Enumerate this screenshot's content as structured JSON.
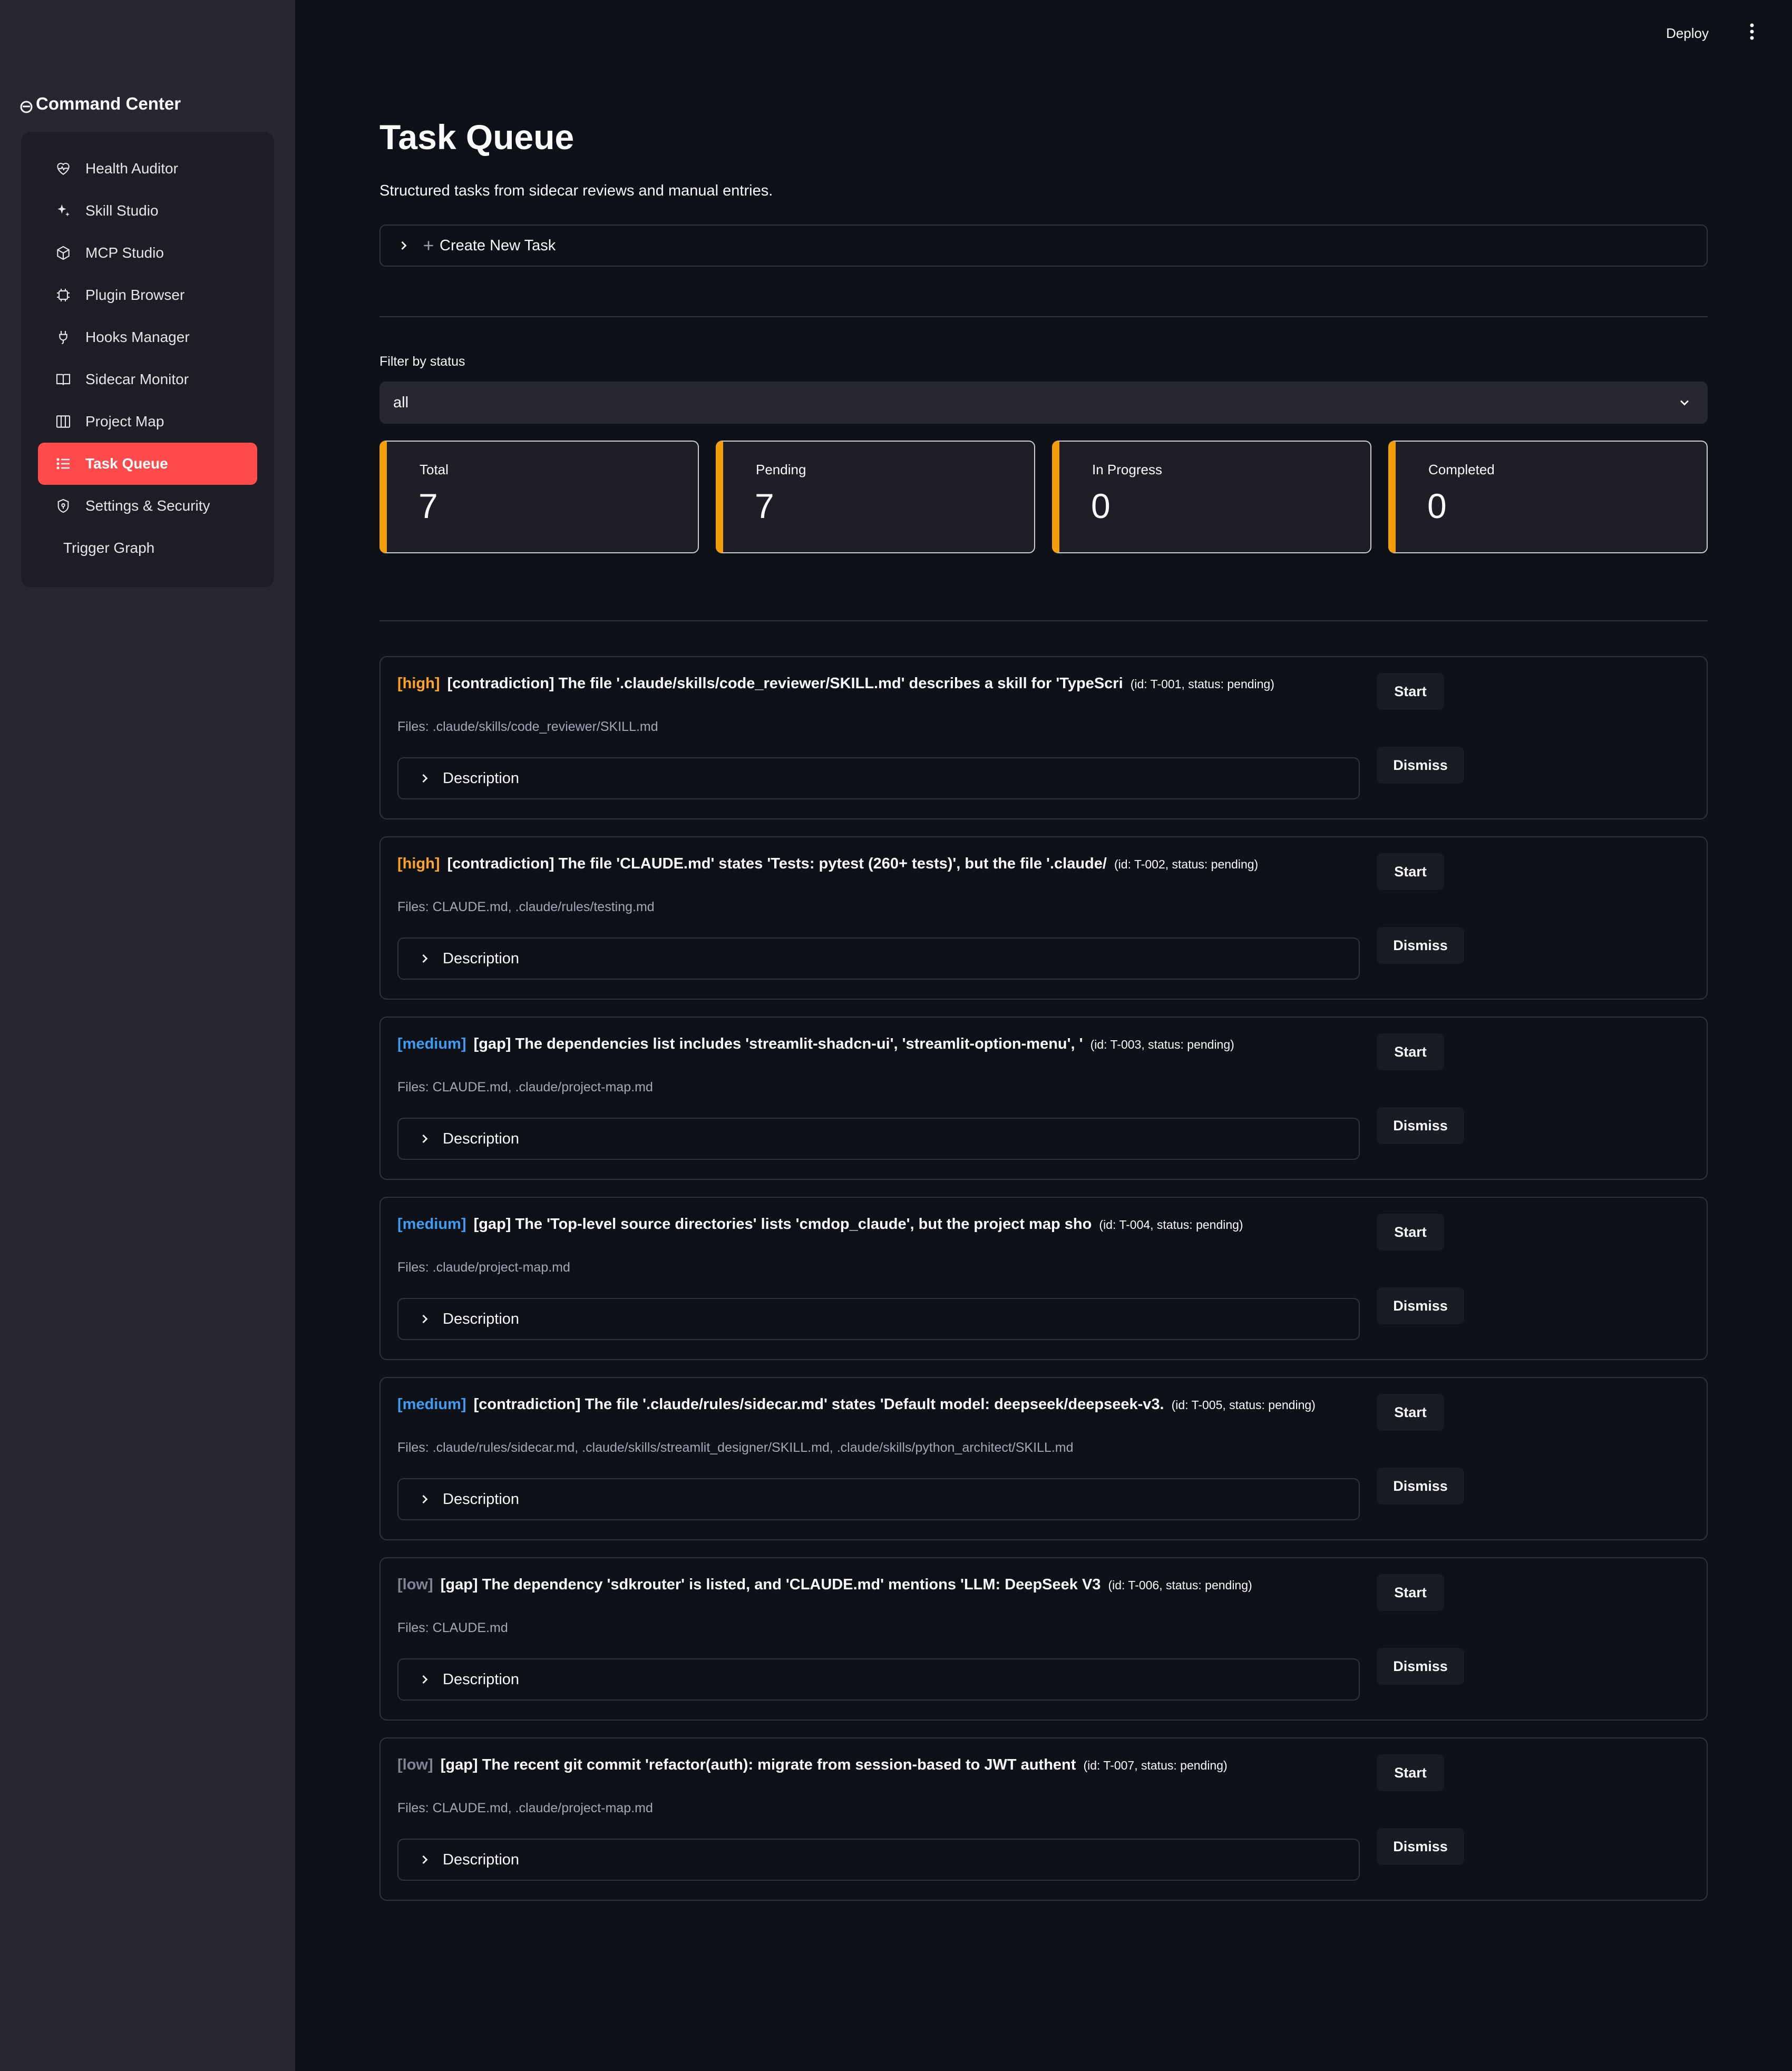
{
  "header": {
    "deploy_label": "Deploy",
    "menu_icon": "kebab-menu-icon"
  },
  "sidebar": {
    "app_title": "Command Center",
    "items": [
      {
        "label": "Health Auditor",
        "icon": "heart-pulse-icon",
        "active": false
      },
      {
        "label": "Skill Studio",
        "icon": "sparkles-icon",
        "active": false
      },
      {
        "label": "MCP Studio",
        "icon": "cube-icon",
        "active": false
      },
      {
        "label": "Plugin Browser",
        "icon": "cpu-chip-icon",
        "active": false
      },
      {
        "label": "Hooks Manager",
        "icon": "plug-icon",
        "active": false
      },
      {
        "label": "Sidecar Monitor",
        "icon": "book-open-icon",
        "active": false
      },
      {
        "label": "Project Map",
        "icon": "map-columns-icon",
        "active": false
      },
      {
        "label": "Task Queue",
        "icon": "list-icon",
        "active": true
      },
      {
        "label": "Settings & Security",
        "icon": "shield-icon",
        "active": false
      },
      {
        "label": "Trigger Graph",
        "icon": "",
        "active": false
      }
    ],
    "accent_color": "#ff4b4b"
  },
  "main": {
    "title": "Task Queue",
    "subtitle": "Structured tasks from sidecar reviews and manual entries.",
    "create_task_label": "Create New Task",
    "filter": {
      "label": "Filter by status",
      "selected": "all"
    },
    "metrics": [
      {
        "label": "Total",
        "value": "7"
      },
      {
        "label": "Pending",
        "value": "7"
      },
      {
        "label": "In Progress",
        "value": "0"
      },
      {
        "label": "Completed",
        "value": "0"
      }
    ],
    "tasks": [
      {
        "priority": "[high]",
        "priority_level": "high",
        "title": "[contradiction] The file '.claude/skills/code_reviewer/SKILL.md' describes a skill for 'TypeScri",
        "meta": "(id: T-001, status: pending)",
        "files": "Files: .claude/skills/code_reviewer/SKILL.md",
        "description_label": "Description",
        "start_label": "Start",
        "dismiss_label": "Dismiss"
      },
      {
        "priority": "[high]",
        "priority_level": "high",
        "title": "[contradiction] The file 'CLAUDE.md' states 'Tests: pytest (260+ tests)', but the file '.claude/",
        "meta": "(id: T-002, status: pending)",
        "files": "Files: CLAUDE.md, .claude/rules/testing.md",
        "description_label": "Description",
        "start_label": "Start",
        "dismiss_label": "Dismiss"
      },
      {
        "priority": "[medium]",
        "priority_level": "medium",
        "title": "[gap] The dependencies list includes 'streamlit-shadcn-ui', 'streamlit-option-menu', '",
        "meta": "(id: T-003, status: pending)",
        "files": "Files: CLAUDE.md, .claude/project-map.md",
        "description_label": "Description",
        "start_label": "Start",
        "dismiss_label": "Dismiss"
      },
      {
        "priority": "[medium]",
        "priority_level": "medium",
        "title": "[gap] The 'Top-level source directories' lists 'cmdop_claude', but the project map sho",
        "meta": "(id: T-004, status: pending)",
        "files": "Files: .claude/project-map.md",
        "description_label": "Description",
        "start_label": "Start",
        "dismiss_label": "Dismiss"
      },
      {
        "priority": "[medium]",
        "priority_level": "medium",
        "title": "[contradiction] The file '.claude/rules/sidecar.md' states 'Default model: deepseek/deepseek-v3.",
        "meta": "(id: T-005, status: pending)",
        "files": "Files: .claude/rules/sidecar.md, .claude/skills/streamlit_designer/SKILL.md, .claude/skills/python_architect/SKILL.md",
        "description_label": "Description",
        "start_label": "Start",
        "dismiss_label": "Dismiss"
      },
      {
        "priority": "[low]",
        "priority_level": "low",
        "title": "[gap] The dependency 'sdkrouter' is listed, and 'CLAUDE.md' mentions 'LLM: DeepSeek V3",
        "meta": "(id: T-006, status: pending)",
        "files": "Files: CLAUDE.md",
        "description_label": "Description",
        "start_label": "Start",
        "dismiss_label": "Dismiss"
      },
      {
        "priority": "[low]",
        "priority_level": "low",
        "title": "[gap] The recent git commit 'refactor(auth): migrate from session-based to JWT authent",
        "meta": "(id: T-007, status: pending)",
        "files": "Files: CLAUDE.md, .claude/project-map.md",
        "description_label": "Description",
        "start_label": "Start",
        "dismiss_label": "Dismiss"
      }
    ],
    "colors": {
      "high": "#ffa421",
      "medium": "#3d9df3",
      "low": "#808495",
      "metric_accent": "#f59e0b"
    }
  }
}
